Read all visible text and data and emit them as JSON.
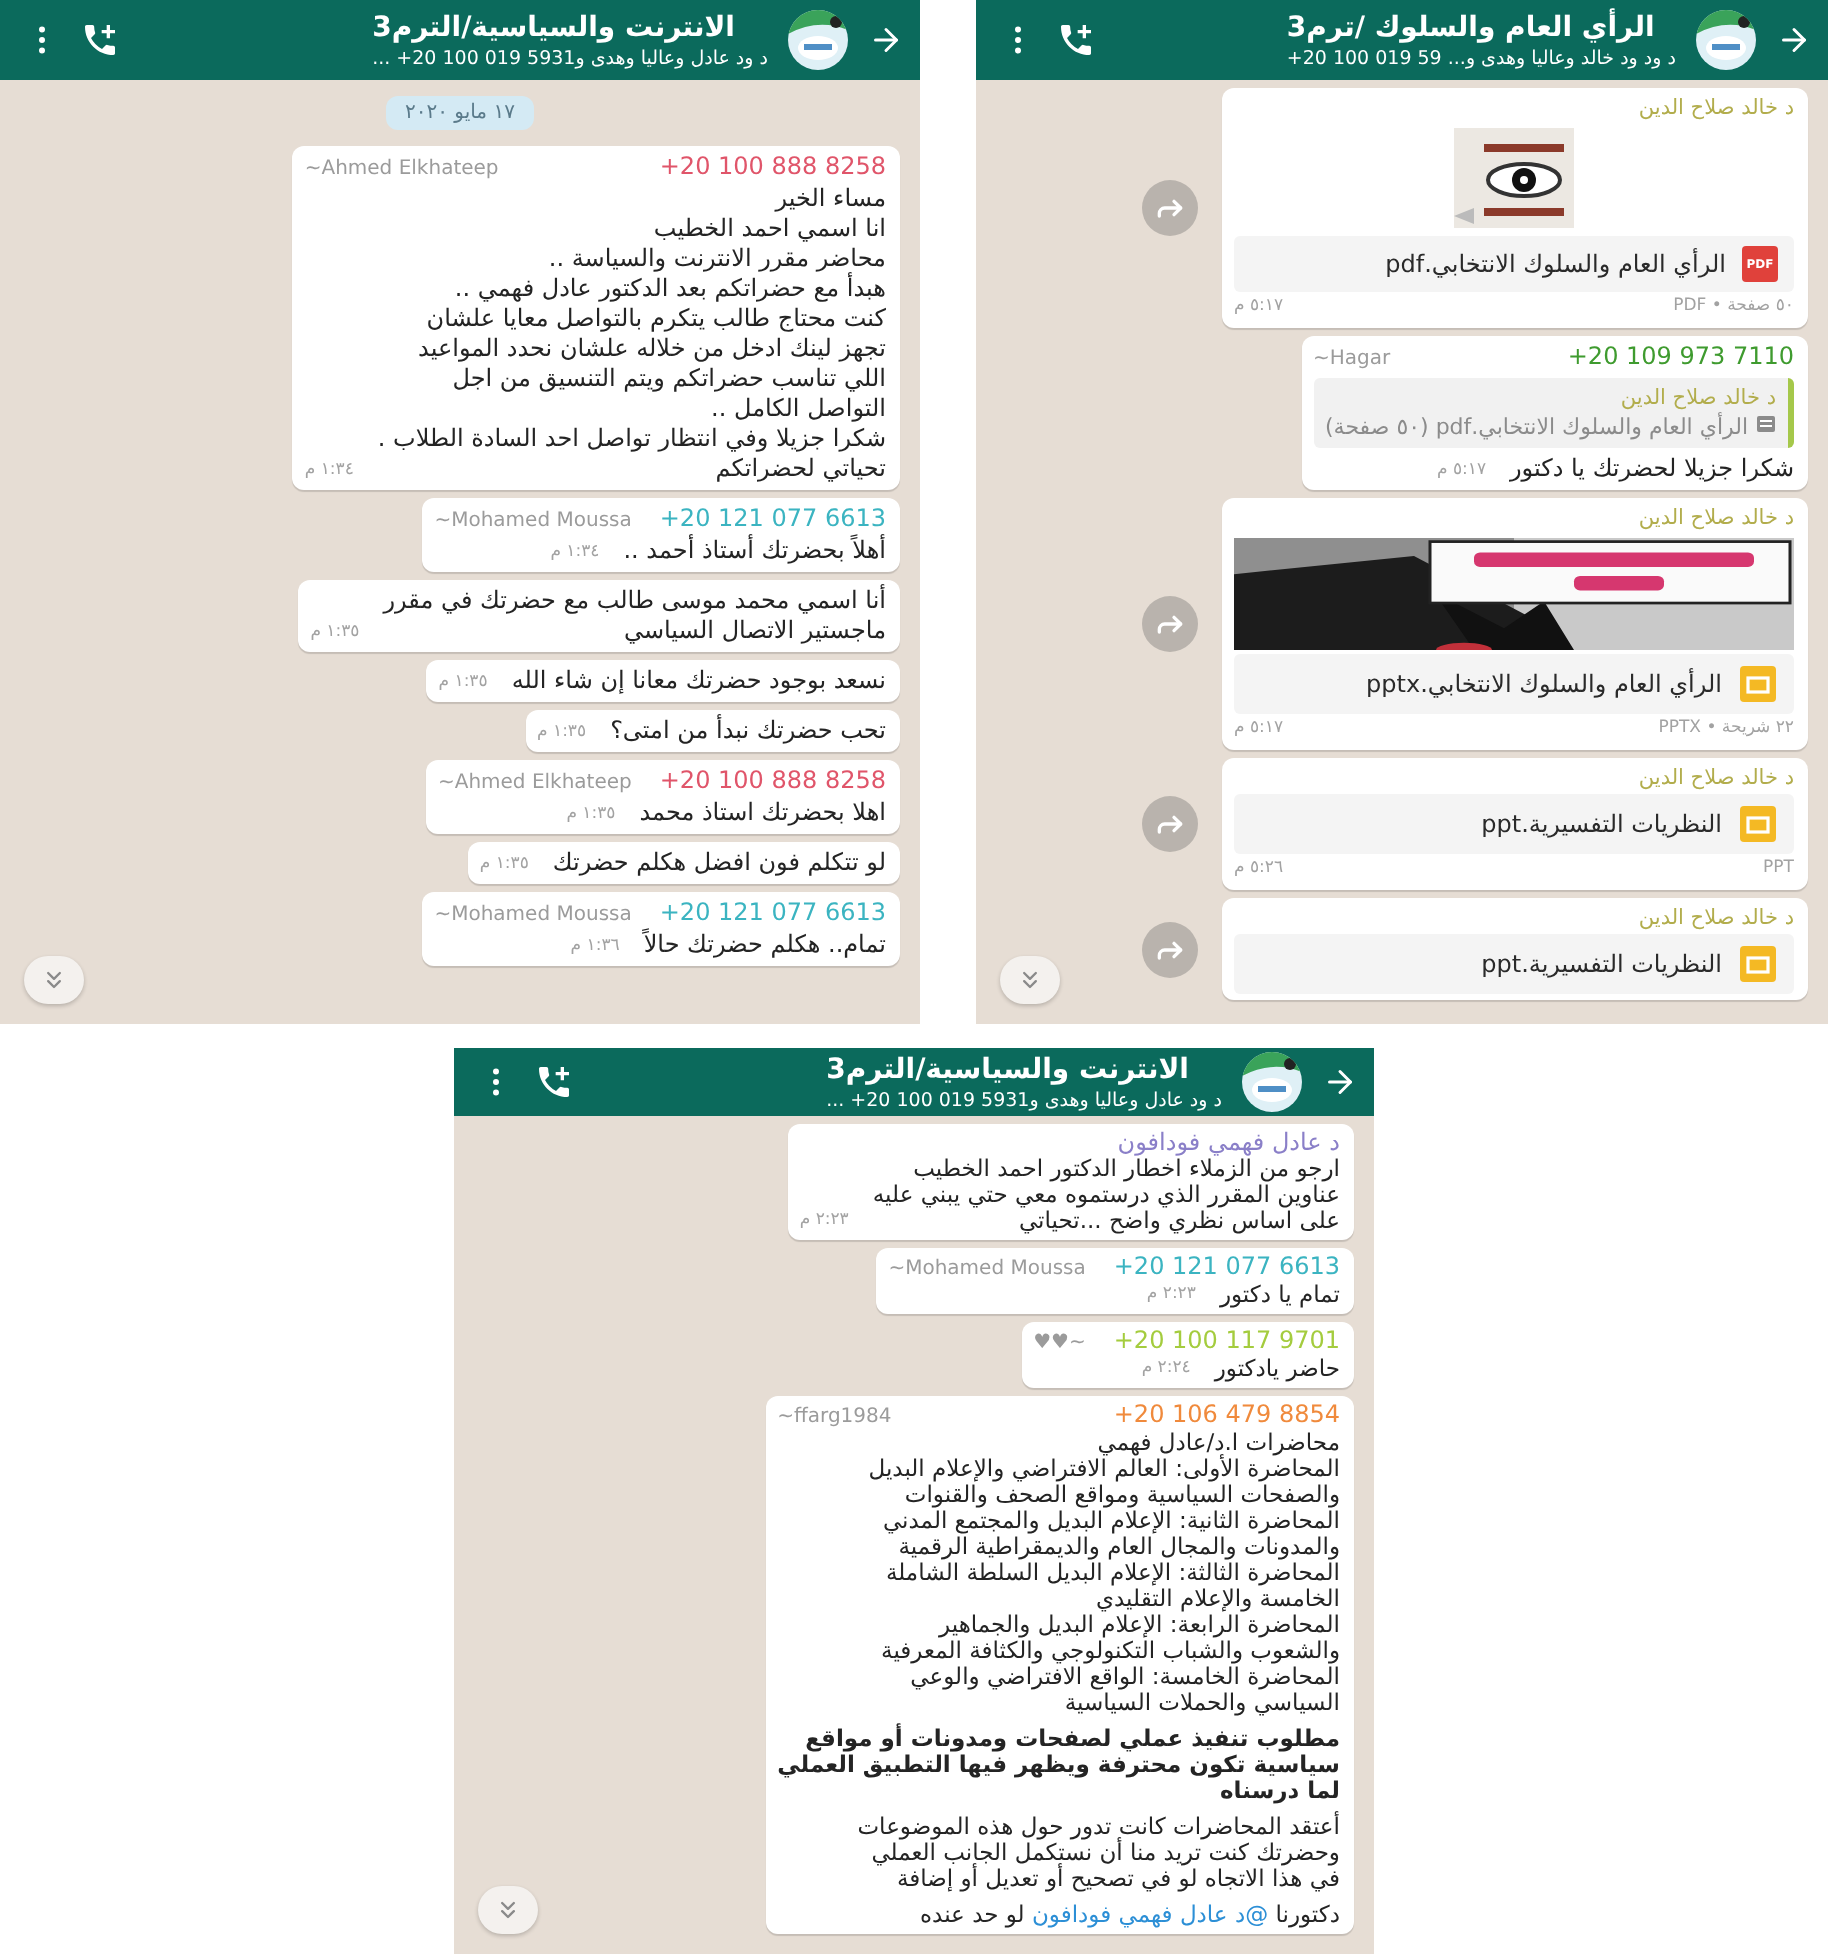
{
  "panels": [
    {
      "header": {
        "title": "الرأي العام والسلوك /ترم3",
        "subtitle": "د ود ود خالد وعاليا وهدى و... ‎+20 100 019 59"
      },
      "messages": [
        {
          "kind": "document",
          "author": "د خالد صلاح الدين",
          "badge": "PDF",
          "filename": "الرأي العام والسلوك الانتخابي.pdf",
          "meta": "٥٠ صفحة • PDF",
          "time": "٥:١٧ م"
        },
        {
          "kind": "text",
          "sender": "~Hagar",
          "phone": "+20 109 973 7110",
          "color": "#3f9b2f",
          "quote": {
            "author": "د خالد صلاح الدين",
            "text": "الرأي العام والسلوك الانتخابي.pdf (٥٠ صفحة)"
          },
          "paragraphs": [
            {
              "text": "شكرا جزيلا لحضرتك يا دكتور",
              "bold": false
            }
          ],
          "time": "٥:١٧ م"
        },
        {
          "kind": "document",
          "author": "د خالد صلاح الدين",
          "filename": "الرأي العام والسلوك الانتخابي.pptx",
          "meta": "٢٢ شريحة • PPTX",
          "time": "٥:١٧ م"
        },
        {
          "kind": "document",
          "author": "د خالد صلاح الدين",
          "filename": "النظريات التفسيرية.ppt",
          "meta": "PPT",
          "time": "٥:٢٦ م"
        },
        {
          "kind": "document",
          "author": "د خالد صلاح الدين",
          "filename": "النظريات التفسيرية.ppt"
        }
      ]
    },
    {
      "header": {
        "title": "الانترنت والسياسية/الترم3",
        "subtitle": "د ود عادل وعاليا وهدى و‎+20 100 019 5931 ..."
      },
      "messages": [
        {
          "kind": "date",
          "text": "١٧ مايو ٢٠٢٠"
        },
        {
          "kind": "text",
          "sender": "~Ahmed Elkhateep",
          "phone": "+20 100 888 8258",
          "color": "#e0556a",
          "paragraphs": [
            {
              "text": "مساء الخير\nانا اسمي احمد الخطيب\nمحاضر مقرر الانترنت والسياسة ..\nهبدأ مع حضراتكم بعد الدكتور عادل فهمي ..\nكنت محتاج طالب يتكرم بالتواصل معايا علشان\nتجهز لينك ادخل من خلاله علشان نحدد المواعيد\nاللي تناسب حضراتكم ويتم التنسيق من اجل\nالتواصل الكامل ..\nشكرا جزيلا وفي انتظار تواصل احد السادة الطلاب .\nتحياتي لحضراتكم",
              "bold": false
            }
          ],
          "time": "١:٣٤ م"
        },
        {
          "kind": "text",
          "sender": "~Mohamed Moussa",
          "phone": "+20 121 077 6613",
          "color": "#3bb4c1",
          "paragraphs": [
            {
              "text": "أهلاً بحضرتك أستاذ أحمد ..",
              "bold": false
            }
          ],
          "time": "١:٣٤ م"
        },
        {
          "kind": "text",
          "paragraphs": [
            {
              "text": "أنا اسمي محمد موسى طالب مع حضرتك في مقرر\nماجستير الاتصال السياسي",
              "bold": false
            }
          ],
          "time": "١:٣٥ م"
        },
        {
          "kind": "text",
          "paragraphs": [
            {
              "text": "نسعد بوجود حضرتك معانا إن شاء الله",
              "bold": false
            }
          ],
          "time": "١:٣٥ م"
        },
        {
          "kind": "text",
          "paragraphs": [
            {
              "text": "تحب حضرتك نبدأ من امتى؟",
              "bold": false
            }
          ],
          "time": "١:٣٥ م"
        },
        {
          "kind": "text",
          "sender": "~Ahmed Elkhateep",
          "phone": "+20 100 888 8258",
          "color": "#e0556a",
          "paragraphs": [
            {
              "text": "اهلا بحضرتك استاذ محمد",
              "bold": false
            }
          ],
          "time": "١:٣٥ م"
        },
        {
          "kind": "text",
          "paragraphs": [
            {
              "text": "لو تتكلم فون افضل هكلم حضرتك",
              "bold": false
            }
          ],
          "time": "١:٣٥ م"
        },
        {
          "kind": "text",
          "sender": "~Mohamed Moussa",
          "phone": "+20 121 077 6613",
          "color": "#3bb4c1",
          "paragraphs": [
            {
              "text": "تمام.. هكلم حضرتك حالاً",
              "bold": false
            }
          ],
          "time": "١:٣٦ م"
        }
      ]
    },
    {
      "header": {
        "title": "الانترنت والسياسية/الترم3",
        "subtitle": "د ود عادل وعاليا وهدى و‎+20 100 019 5931 ..."
      },
      "messages": [
        {
          "kind": "text",
          "contact": "د عادل فهمي فودافون",
          "color": "#8a7fc8",
          "paragraphs": [
            {
              "text": "ارجو من الزملاء اخطار الدكتور احمد الخطيب\nعناوين المقرر الذي درستموه معي حتي يبني عليه\nعلى اساس نظري واضح ...تحياتي",
              "bold": false
            }
          ],
          "time": "٢:٢٣ م"
        },
        {
          "kind": "text",
          "sender": "~Mohamed Moussa",
          "phone": "+20 121 077 6613",
          "color": "#3bb4c1",
          "paragraphs": [
            {
              "text": "تمام يا دكتور",
              "bold": false
            }
          ],
          "time": "٢:٢٣ م"
        },
        {
          "kind": "text",
          "sender": "♥♥~",
          "phone": "+20 100 117 9701",
          "color": "#a4cc3e",
          "paragraphs": [
            {
              "text": "حاضر يادكتور",
              "bold": false
            }
          ],
          "time": "٢:٢٤ م"
        },
        {
          "kind": "text",
          "sender": "~ffarg1984",
          "phone": "+20 106 479 8854",
          "color": "#f08a3c",
          "paragraphs": [
            {
              "text": "محاضرات ا.د/عادل فهمي\nالمحاضرة الأولى: العالم الافتراضي والإعلام البديل\nوالصفحات السياسية ومواقع الصحف والقنوات\nالمحاضرة الثانية: الإعلام البديل والمجتمع المدني\nوالمدونات والمجال العام والديمقراطية الرقمية\nالمحاضرة الثالثة: الإعلام البديل السلطة الشاملة\nالخامسة والإعلام التقليدي\nالمحاضرة الرابعة: الإعلام البديل والجماهير\nوالشعوب والشباب التكنولوجي والكثافة المعرفية\nالمحاضرة الخامسة: الواقع الافتراضي والوعي\nالسياسي والحملات السياسية",
              "bold": false
            },
            {
              "text": "مطلوب تنفيذ عملي لصفحات ومدونات أو مواقع\nسياسية تكون محترفة ويظهر فيها التطبيق العملي\nلما درسناه",
              "bold": true
            },
            {
              "text": "أعتقد المحاضرات كانت تدور حول هذه الموضوعات\nوحضرتك كنت تريد منا أن نستكمل الجانب العملي\nفي هذا الاتجاه لو في تصحيح أو تعديل أو إضافة",
              "bold": false
            }
          ],
          "mention": {
            "before": "دكتورنا ",
            "link": "@د عادل فهمي فودافون",
            "after": " لو حد عنده"
          }
        }
      ]
    }
  ]
}
